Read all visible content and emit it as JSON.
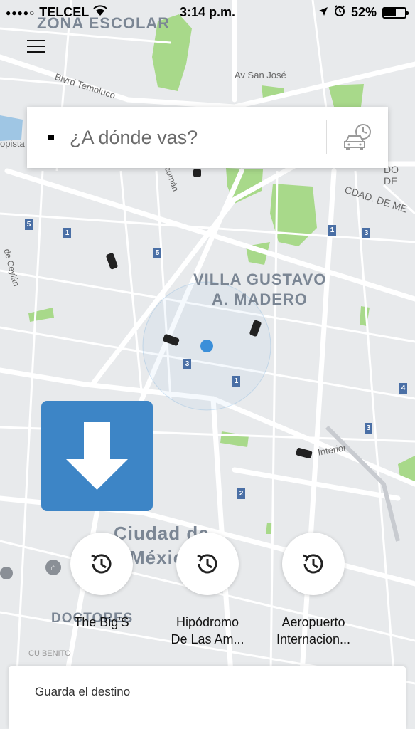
{
  "status_bar": {
    "signal": "●●●●○",
    "carrier": "TELCEL",
    "time": "3:14 p.m.",
    "battery_text": "52%",
    "battery_level": 0.52
  },
  "map": {
    "labels": {
      "zona_escolar": "ZONA ESCOLAR",
      "blvrd_temoluco": "Blvrd Temoluco",
      "av_san_jose": "Av San José",
      "villa_1": "VILLA GUSTAVO",
      "villa_2": "A. MADERO",
      "cdad_de_me": "CDAD. DE ME",
      "do_de": "DO DE",
      "ciudad_1": "Ciudad de",
      "ciudad_2": "México",
      "doctores": "DOCTORES",
      "cu_benito": "CU BENITO",
      "interior": "Interior",
      "opista": "opista",
      "ceylan": "de Ceylán",
      "coman": "comán"
    },
    "road_badges": [
      "5",
      "1",
      "5",
      "1",
      "3",
      "3",
      "1",
      "4",
      "3",
      "2"
    ]
  },
  "search": {
    "placeholder": "¿A dónde vas?"
  },
  "shortcuts": [
    {
      "label": "The Big'S"
    },
    {
      "label": "Hipódromo\nDe Las Am..."
    },
    {
      "label": "Aeropuerto\nInternacion..."
    }
  ],
  "save_destination": {
    "label": "Guarda el destino"
  },
  "colors": {
    "accent": "#3d85c6",
    "park": "#a8d98a",
    "location_dot": "#3b8fd9"
  }
}
